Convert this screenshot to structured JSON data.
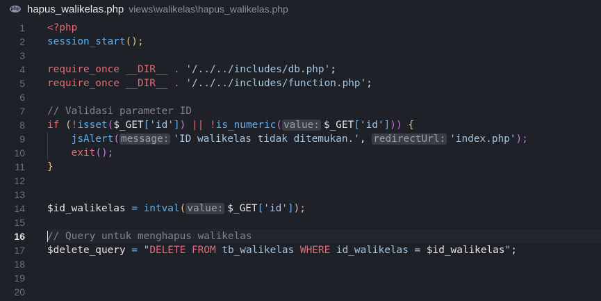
{
  "tab": {
    "icon_text": "php",
    "filename": "hapus_walikelas.php",
    "path": "views\\walikelas\\hapus_walikelas.php"
  },
  "editor": {
    "active_line": 16,
    "line_numbers": [
      "1",
      "2",
      "3",
      "4",
      "5",
      "6",
      "7",
      "8",
      "9",
      "10",
      "11",
      "12",
      "13",
      "14",
      "15",
      "16",
      "17",
      "18",
      "19",
      "20"
    ],
    "tokens": {
      "l1_open": "<?php",
      "l2_fn": "session_start",
      "l2_paren": "();",
      "l4_kw": "require_once",
      "l4_dir": "__DIR__",
      "l4_dot": ".",
      "l4_str": "'/../../includes/db.php'",
      "l4_semi": ";",
      "l5_kw": "require_once",
      "l5_dir": "__DIR__",
      "l5_dot": ".",
      "l5_str": "'/../../includes/function.php'",
      "l5_semi": ";",
      "l7_comment": "// Validasi parameter ID",
      "l8_if": "if",
      "l8_p1": " (",
      "l8_not1": "!",
      "l8_isset": "isset",
      "l8_p2": "(",
      "l8_get1": "$_GET",
      "l8_b1": "[",
      "l8_id1": "'id'",
      "l8_b2": "]",
      "l8_p3": ")",
      "l8_or": " || ",
      "l8_not2": "!",
      "l8_isnum": "is_numeric",
      "l8_p4": "(",
      "l8_hint": "value:",
      "l8_get2": "$_GET",
      "l8_b3": "[",
      "l8_id2": "'id'",
      "l8_b4": "]",
      "l8_p5": "))",
      "l8_brace": " {",
      "l9_fn": "jsAlert",
      "l9_p1": "(",
      "l9_hint1": "message:",
      "l9_str1": "'ID walikelas tidak ditemukan.'",
      "l9_comma": ", ",
      "l9_hint2": "redirectUrl:",
      "l9_str2": "'index.php'",
      "l9_end": ");",
      "l10_fn": "exit",
      "l10_end": "();",
      "l11_brace": "}",
      "l14_var": "$id_walikelas",
      "l14_eq": " = ",
      "l14_fn": "intval",
      "l14_p1": "(",
      "l14_hint": "value:",
      "l14_get": "$_GET",
      "l14_b1": "[",
      "l14_id": "'id'",
      "l14_b2": "]",
      "l14_end": ");",
      "l16_comment": "// Query untuk menghapus walikelas",
      "l17_var": "$delete_query",
      "l17_eq": " = ",
      "l17_q1": "\"",
      "l17_sql1": "DELETE FROM",
      "l17_t": " tb_walikelas ",
      "l17_sql2": "WHERE",
      "l17_c": " id_walikelas = ",
      "l17_v": "$id_walikelas",
      "l17_q2": "\"",
      "l17_semi": ";"
    }
  },
  "colors": {
    "background": "#1e2127",
    "keyword": "#e06c75",
    "function": "#61afef",
    "comment": "#7f848e",
    "string": "#a8c4e0"
  }
}
